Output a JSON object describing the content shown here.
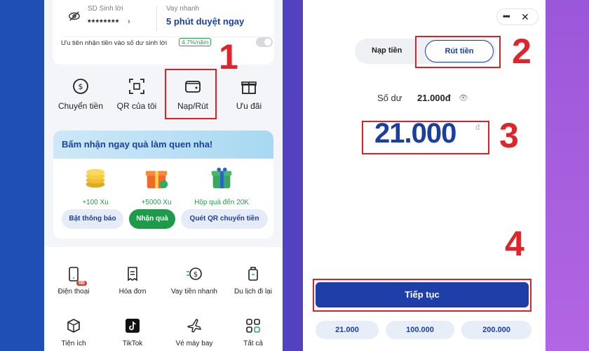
{
  "left_panel": {
    "sd_sinh_loi_label": "SD Sinh lời",
    "sd_sinh_loi_value": "********",
    "vay_nhanh_label": "Vay nhanh",
    "vay_nhanh_value": "5 phút duyệt ngay",
    "priority_text": "Ưu tiên nhận tiền vào số dư sinh lời",
    "priority_rate": "4.7%/năm",
    "quick_actions": [
      {
        "label": "Chuyển tiền",
        "icon": "transfer-icon"
      },
      {
        "label": "QR của tôi",
        "icon": "qr-icon"
      },
      {
        "label": "Nạp/Rút",
        "icon": "wallet-icon"
      },
      {
        "label": "Ưu đãi",
        "icon": "gift-icon"
      }
    ],
    "promo": {
      "title": "Bấm nhận ngay quà làm quen nha!",
      "gifts": [
        {
          "label": "+100 Xu",
          "icon": "coins-icon"
        },
        {
          "label": "+5000 Xu",
          "icon": "giftbox-icon"
        },
        {
          "label": "Hộp quà đến 20K",
          "icon": "present-icon"
        }
      ],
      "buttons": [
        "Bật thông báo",
        "Nhận quà",
        "Quét QR chuyển tiền"
      ]
    },
    "services": [
      {
        "label": "Điện thoại",
        "icon": "phone-icon",
        "badge": "0Đ"
      },
      {
        "label": "Hóa đơn",
        "icon": "bill-icon"
      },
      {
        "label": "Vay tiền nhanh",
        "icon": "loan-icon"
      },
      {
        "label": "Du lịch đi lại",
        "icon": "luggage-icon"
      },
      {
        "label": "Tiện ích",
        "icon": "box-icon"
      },
      {
        "label": "TikTok",
        "icon": "tiktok-icon"
      },
      {
        "label": "Vé máy bay",
        "icon": "plane-icon"
      },
      {
        "label": "Tất cả",
        "icon": "grid-icon"
      }
    ]
  },
  "right_panel": {
    "tab_deposit": "Nạp tiền",
    "tab_withdraw": "Rút tiền",
    "balance_label": "Số dư",
    "balance_value": "21.000đ",
    "amount": "21.000",
    "amount_unit": "đ",
    "continue_label": "Tiếp tục",
    "chips": [
      "21.000",
      "100.000",
      "200.000"
    ]
  },
  "steps": [
    "1",
    "2",
    "3",
    "4"
  ],
  "colors": {
    "accent": "#1a3fa0",
    "highlight": "#d8232a",
    "green": "#1f9a4a"
  }
}
